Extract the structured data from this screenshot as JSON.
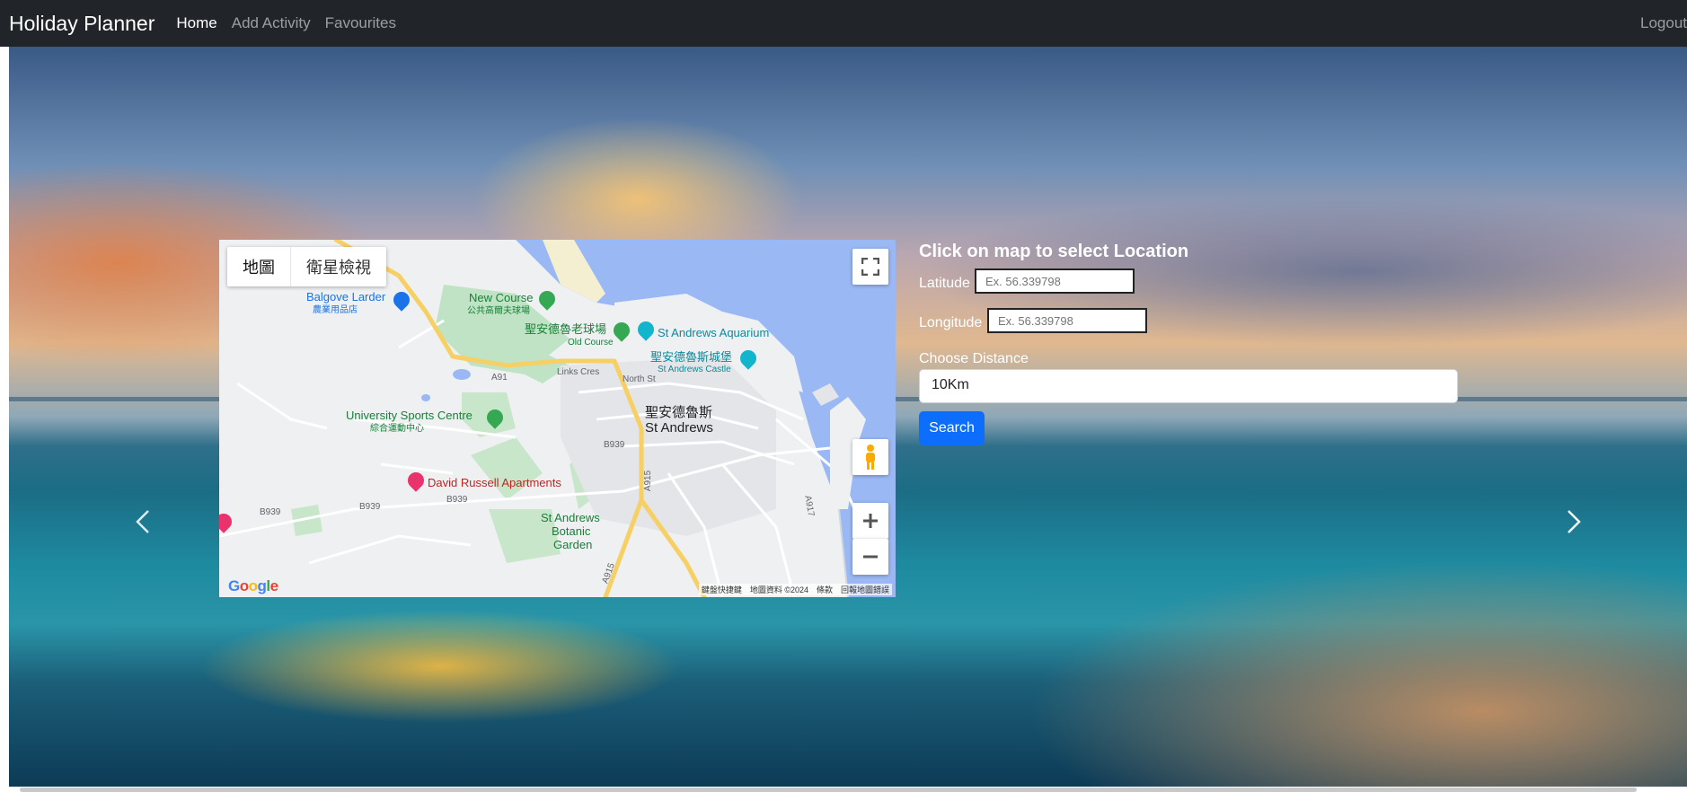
{
  "navbar": {
    "brand": "Holiday Planner",
    "links": [
      "Home",
      "Add Activity",
      "Favourites"
    ],
    "logout": "Logout"
  },
  "map": {
    "type_buttons": [
      "地圖",
      "衛星檢視"
    ],
    "places": {
      "balgove": "Balgove Larder",
      "balgove_sub": "農業用品店",
      "new_course": "New Course",
      "new_course_sub": "公共高爾夫球場",
      "old_course": "聖安德魯老球場",
      "old_course_sub": "Old Course",
      "aquarium": "St Andrews Aquarium",
      "castle": "聖安德魯斯城堡",
      "castle_sub": "St Andrews Castle",
      "town_zh": "聖安德魯斯",
      "town_en": "St Andrews",
      "sports": "University Sports Centre",
      "sports_sub": "綜合運動中心",
      "apartments": "David Russell Apartments",
      "garden1": "St Andrews",
      "garden2": "Botanic",
      "garden3": "Garden",
      "road_a91": "A91",
      "road_links": "Links Cres",
      "road_north": "North St",
      "road_b939a": "B939",
      "road_b939b": "B939",
      "road_b939c": "B939",
      "road_b939d": "B939",
      "road_a915a": "A915",
      "road_a915b": "A915",
      "road_a917": "A917"
    },
    "footer": "鍵盤快捷鍵　地圖資料 ©2024　條款　回報地圖錯誤",
    "google": "Google",
    "icons": [
      "fullscreen-icon",
      "pegman-icon",
      "zoom-in-icon",
      "zoom-out-icon"
    ]
  },
  "form": {
    "title": "Click on map to select Location",
    "latitude_label": "Latitude",
    "latitude_placeholder": "Ex. 56.339798",
    "longitude_label": "Longitude",
    "longitude_placeholder": "Ex. 56.339798",
    "distance_label": "Choose Distance",
    "distance_value": "10Km",
    "search_button": "Search"
  },
  "colors": {
    "navbar": "#212529",
    "primary": "#0d6efd",
    "poi_green": "#34a853",
    "poi_blue": "#1a73e8",
    "poi_red": "#e8336d",
    "road_yellow": "#f6cf65"
  }
}
